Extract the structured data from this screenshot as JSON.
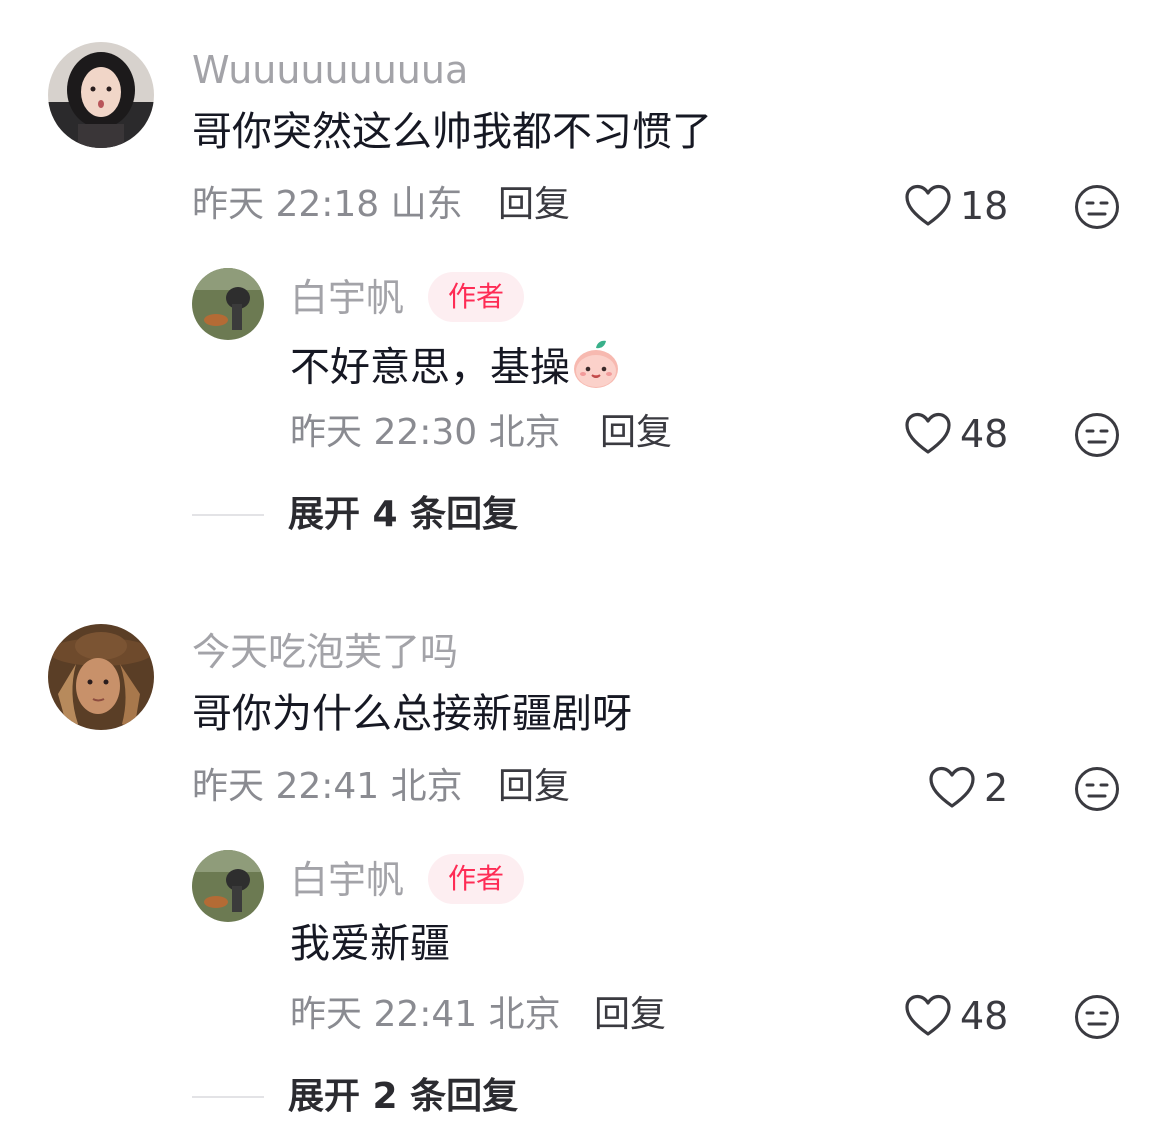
{
  "comments": [
    {
      "username": "Wuuuuuuuuua",
      "text": "哥你突然这么帅我都不习惯了",
      "time": "昨天 22:18",
      "location": "山东",
      "reply_label": "回复",
      "likes": "18",
      "replies": [
        {
          "username": "白宇帆",
          "badge": "作者",
          "text": "不好意思，基操",
          "emoji": "peach-face-emoji",
          "time": "昨天 22:30",
          "location": "北京",
          "reply_label": "回复",
          "likes": "48"
        }
      ],
      "expand_label": "展开 4 条回复"
    },
    {
      "username": "今天吃泡芙了吗",
      "text": "哥你为什么总接新疆剧呀",
      "time": "昨天 22:41",
      "location": "北京",
      "reply_label": "回复",
      "likes": "2",
      "replies": [
        {
          "username": "白宇帆",
          "badge": "作者",
          "text": "我爱新疆",
          "time": "昨天 22:41",
          "location": "北京",
          "reply_label": "回复",
          "likes": "48"
        }
      ],
      "expand_label": "展开 2 条回复"
    }
  ],
  "colors": {
    "accent": "#fe2c55",
    "badge_bg": "#fdeef1",
    "username": "#a3a3a8",
    "text": "#161823",
    "meta": "#8a8b91"
  },
  "icons": {
    "like": "heart-outline-icon",
    "dislike": "neutral-face-icon"
  }
}
